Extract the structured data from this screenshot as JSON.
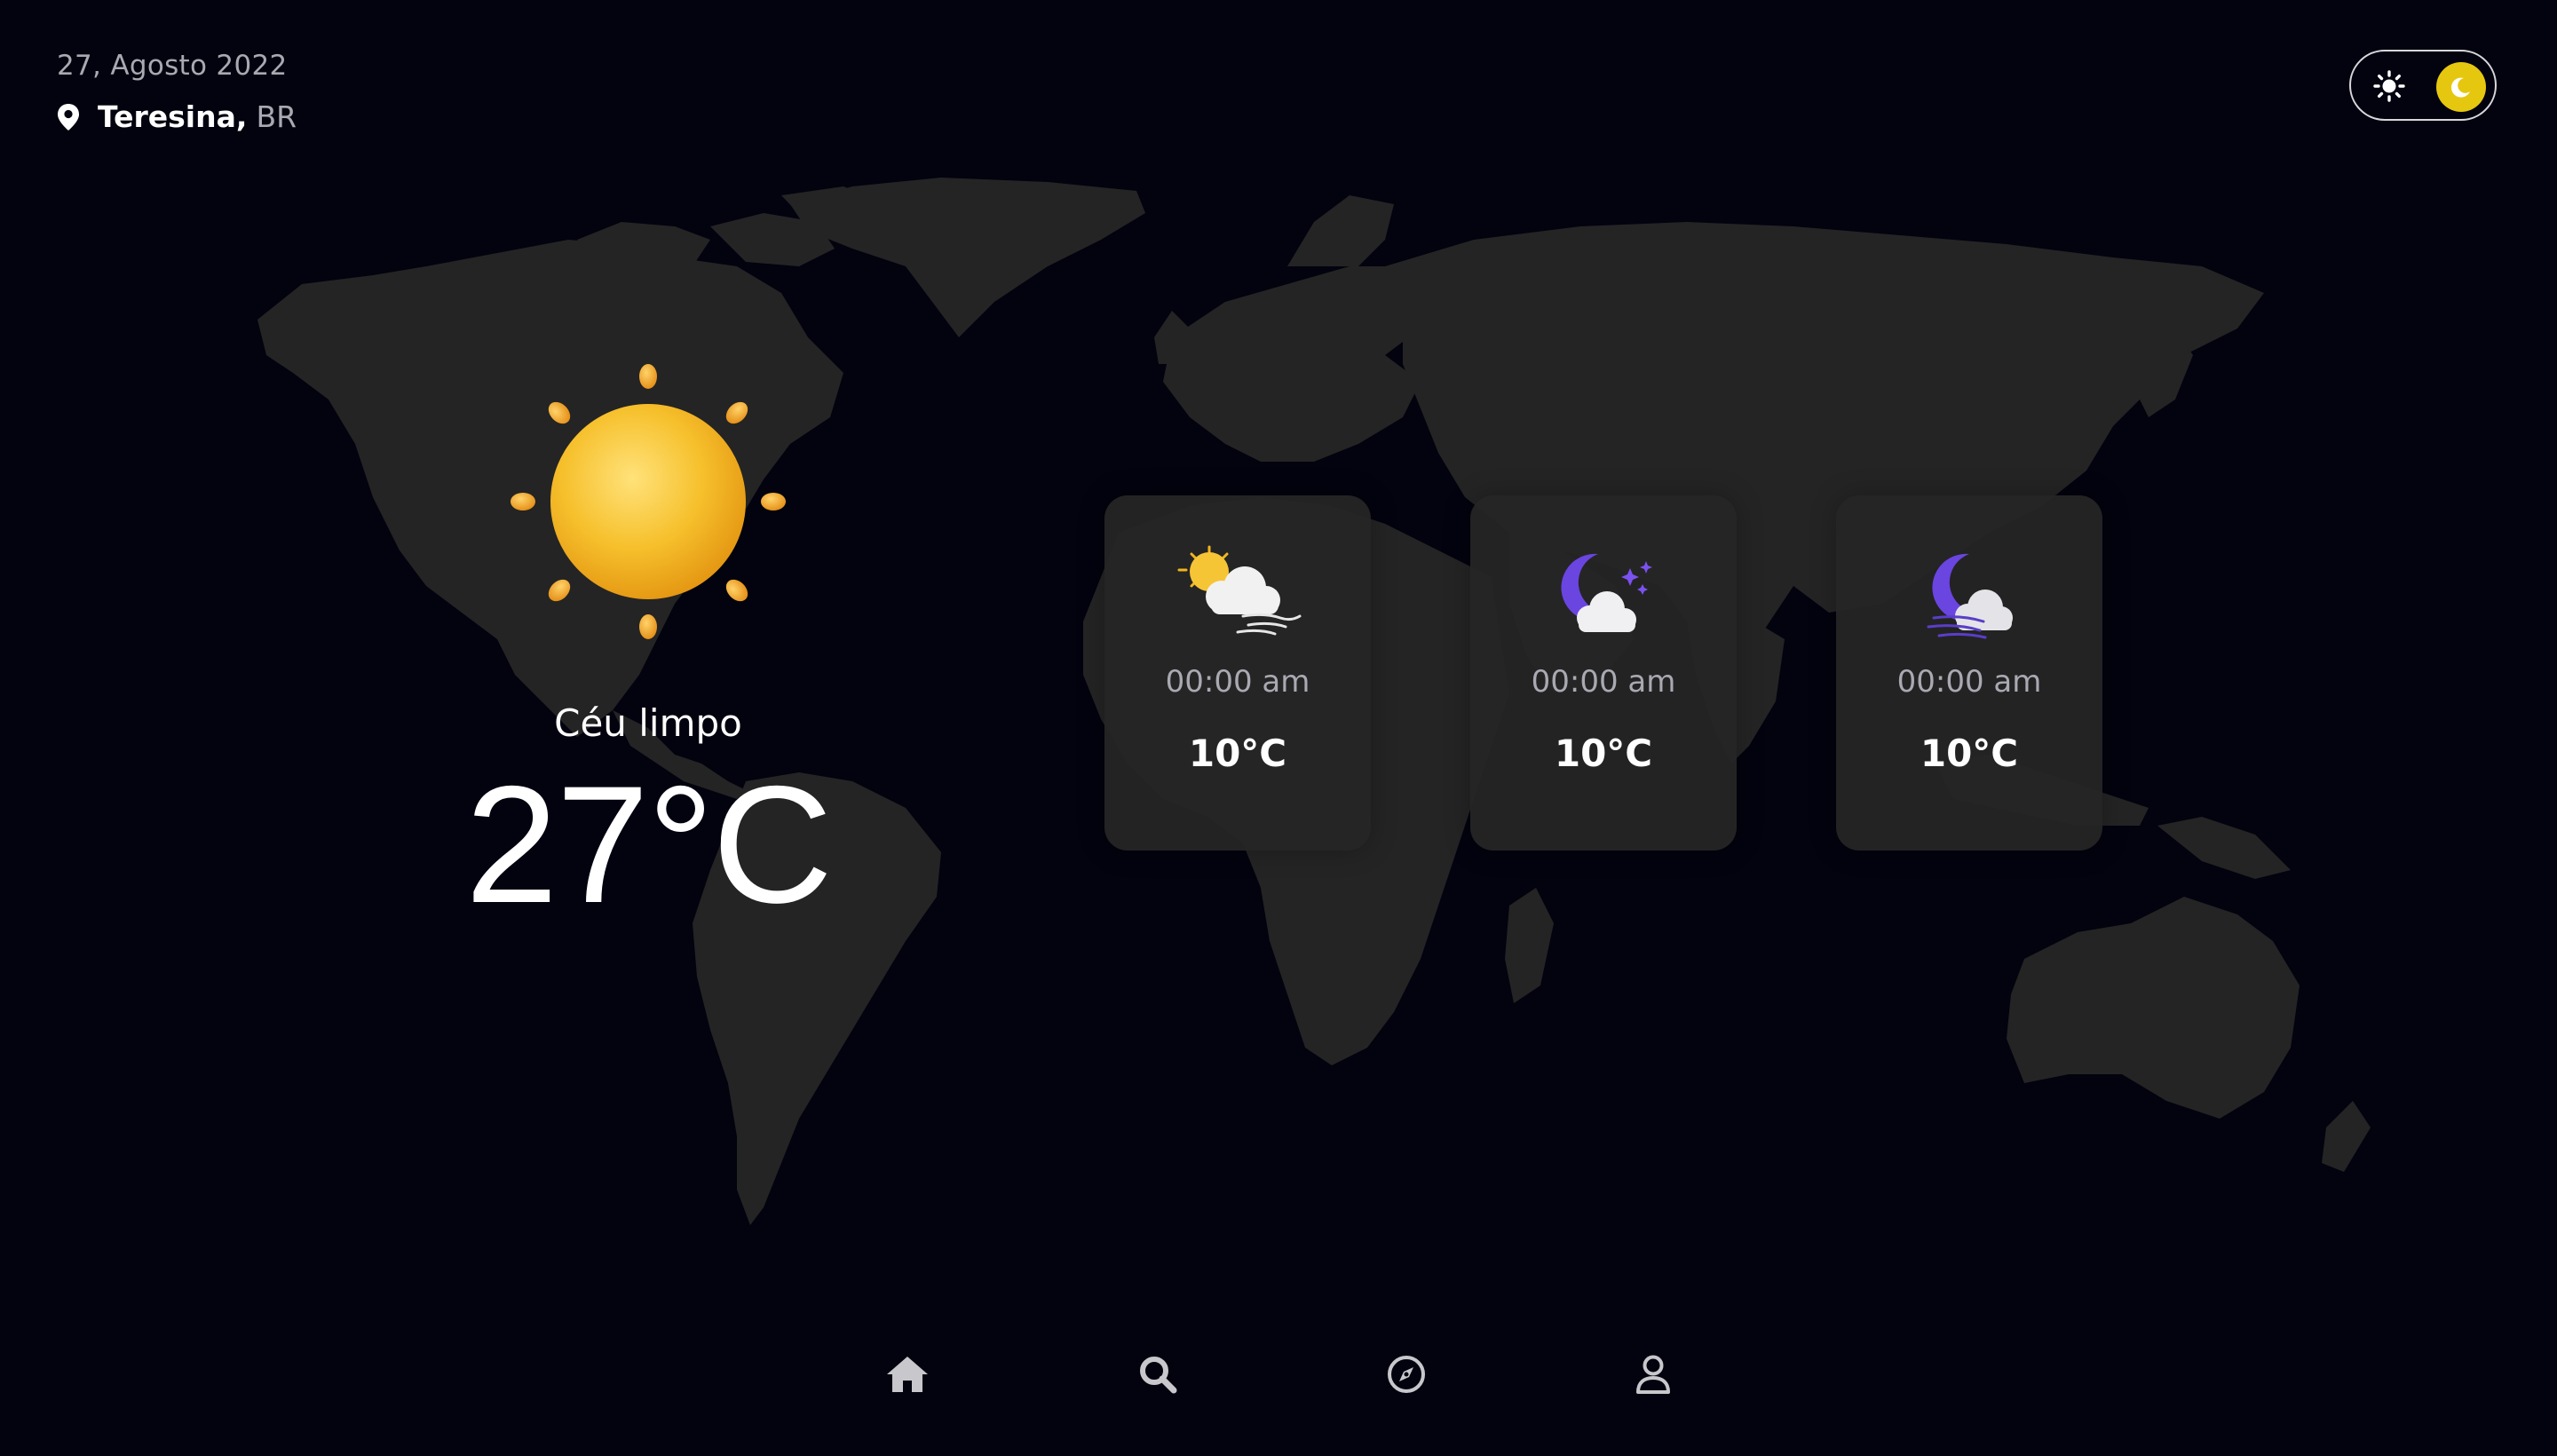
{
  "header": {
    "date": "27, Agosto 2022",
    "city": "Teresina",
    "separator": ",",
    "country": "BR",
    "location_icon": "map-pin-icon"
  },
  "theme_toggle": {
    "left_icon": "sun-icon",
    "right_icon": "moon-icon",
    "active": "dark",
    "knob_color": "#e6c70f"
  },
  "current_weather": {
    "icon": "sun-icon",
    "condition": "Céu limpo",
    "temperature": "27°C"
  },
  "forecast": [
    {
      "icon": "sun-behind-cloud-wind-icon",
      "time": "00:00 am",
      "temp": "10°C"
    },
    {
      "icon": "moon-cloud-stars-icon",
      "time": "00:00 am",
      "temp": "10°C"
    },
    {
      "icon": "moon-cloud-wind-icon",
      "time": "00:00 am",
      "temp": "10°C"
    }
  ],
  "nav": [
    {
      "icon": "home-icon"
    },
    {
      "icon": "search-icon"
    },
    {
      "icon": "compass-icon"
    },
    {
      "icon": "user-icon"
    }
  ],
  "colors": {
    "background": "#03030f",
    "map": "#242424",
    "card": "#262626",
    "accent": "#e6c70f",
    "text": "#ffffff",
    "muted": "#a9a9b2"
  }
}
